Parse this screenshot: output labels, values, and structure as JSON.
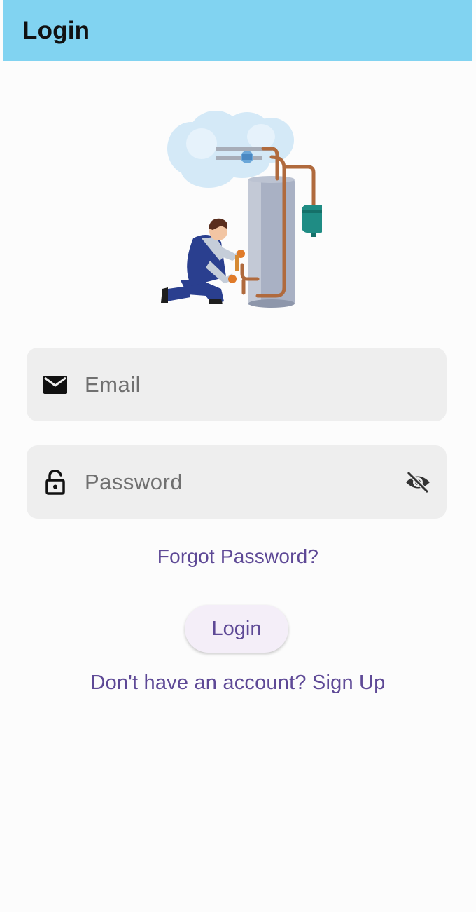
{
  "appbar": {
    "title": "Login"
  },
  "form": {
    "email": {
      "placeholder": "Email",
      "value": "",
      "icon": "mail-icon"
    },
    "password": {
      "placeholder": "Password",
      "value": "",
      "icon": "lock-open-icon",
      "toggle_icon": "eye-off-icon"
    }
  },
  "links": {
    "forgot_password": "Forgot Password?",
    "signup": "Don't have an account? Sign Up"
  },
  "buttons": {
    "login": "Login"
  },
  "colors": {
    "appbar": "#81d3f1",
    "accent": "#5e4996",
    "field_background": "#eeeeee",
    "button_background": "#f4eef8",
    "page_background": "#fcfcfc"
  }
}
